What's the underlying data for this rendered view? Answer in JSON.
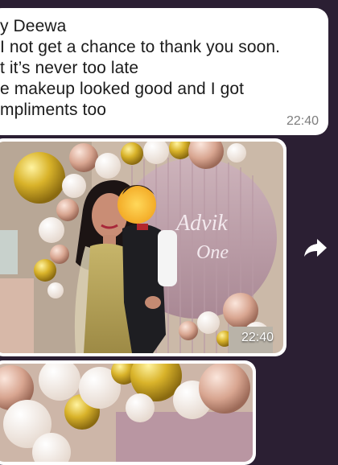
{
  "text_message": {
    "lines": [
      "y Deewa",
      "I not get a chance to thank you soon.",
      "t it’s never too late",
      "e makeup looked good and I got",
      "mpliments too"
    ],
    "time": "22:40"
  },
  "photo_message": {
    "time": "22:40",
    "backdrop_text_line1": "Advik",
    "backdrop_text_line2": "One"
  },
  "forward_icon": "forward-arrow-icon",
  "colors": {
    "chat_background": "#2b1f33",
    "bubble": "#ffffff",
    "timestamp": "#7d7d7d"
  }
}
